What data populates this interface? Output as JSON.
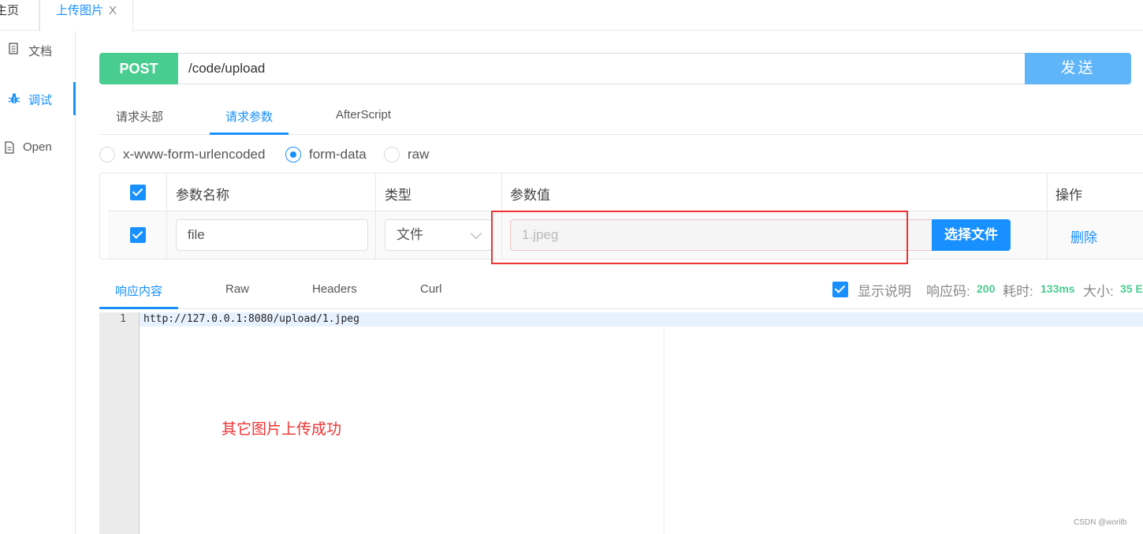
{
  "top_tabs": {
    "home": "主页",
    "upload": "上传图片",
    "close": "X"
  },
  "sidebar": {
    "items": [
      {
        "label": "文档"
      },
      {
        "label": "调试"
      },
      {
        "label": "Open"
      }
    ]
  },
  "request": {
    "method": "POST",
    "url": "/code/upload",
    "send_label": "发送"
  },
  "request_tabs": [
    "请求头部",
    "请求参数",
    "AfterScript"
  ],
  "body_types": [
    "x-www-form-urlencoded",
    "form-data",
    "raw"
  ],
  "param_table": {
    "headers": {
      "name": "参数名称",
      "type": "类型",
      "value": "参数值",
      "action": "操作"
    },
    "rows": [
      {
        "name": "file",
        "type": "文件",
        "value": "1.jpeg",
        "choose_label": "选择文件",
        "delete_label": "删除"
      }
    ]
  },
  "response_tabs": [
    "响应内容",
    "Raw",
    "Headers",
    "Curl"
  ],
  "response_meta": {
    "show_desc": "显示说明",
    "code_label": "响应码:",
    "code": "200",
    "time_label": "耗时:",
    "time": "133ms",
    "size_label": "大小:",
    "size": "35 E"
  },
  "editor": {
    "line_number": "1",
    "code": "http://127.0.0.1:8080/upload/1.jpeg"
  },
  "annotation": "其它图片上传成功",
  "watermark": "CSDN @worilb",
  "colors": {
    "accent": "#1890ff",
    "method_post": "#49cc90",
    "send_button": "#5fb5f8",
    "annotation": "#e33333"
  }
}
